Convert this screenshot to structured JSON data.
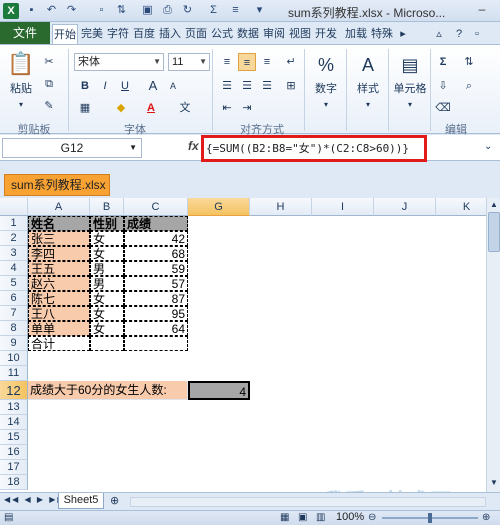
{
  "titlebar": {
    "logo_letter": "X",
    "save_icon": "save-icon",
    "undo_icon": "undo-icon",
    "redo_icon": "redo-icon",
    "title": "sum系列教程.xlsx - Microso...",
    "minimize": "–"
  },
  "ribbon_tabs": {
    "file": "文件",
    "tabs": [
      "开始",
      "完美",
      "字符",
      "百度",
      "插入",
      "页面",
      "公式",
      "数据",
      "审阅",
      "视图",
      "开发",
      "加载",
      "特殊"
    ]
  },
  "ribbon": {
    "paste_label": "粘贴",
    "font_name": "宋体",
    "font_size": "11",
    "font_buttons": [
      "B",
      "I",
      "U",
      "A",
      "A"
    ],
    "number_label": "数字",
    "style_label": "样式",
    "cells_label": "单元格",
    "group_labels": [
      "剪贴板",
      "字体",
      "对齐方式",
      "编辑"
    ]
  },
  "formula_bar": {
    "name_box": "G12",
    "fx": "fx",
    "formula": "{=SUM((B2:B8=\"女\")*(C2:C8>60))}"
  },
  "workbook_tab": {
    "title": "sum系列教程.xlsx"
  },
  "grid": {
    "columns": [
      "A",
      "B",
      "C",
      "G",
      "H",
      "I",
      "J",
      "K"
    ],
    "rows": [
      "1",
      "2",
      "3",
      "4",
      "5",
      "6",
      "7",
      "8",
      "9",
      "10",
      "11",
      "12",
      "13",
      "14",
      "15",
      "16",
      "17",
      "18"
    ],
    "headers": [
      "姓名",
      "性别",
      "成绩"
    ],
    "data": [
      [
        "张三",
        "女",
        "42"
      ],
      [
        "李四",
        "女",
        "68"
      ],
      [
        "王五",
        "男",
        "59"
      ],
      [
        "赵六",
        "男",
        "57"
      ],
      [
        "陈七",
        "女",
        "87"
      ],
      [
        "王八",
        "女",
        "95"
      ],
      [
        "单单",
        "女",
        "64"
      ]
    ],
    "total_label": "合计",
    "question": "成绩大于60分的女生人数:",
    "answer": "4",
    "selected_col": "G",
    "selected_row": "12"
  },
  "sheets": {
    "active": "Sheet5"
  },
  "status": {
    "zoom": "100%"
  }
}
